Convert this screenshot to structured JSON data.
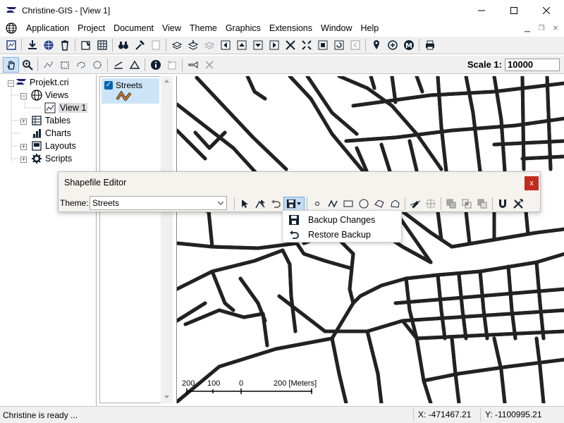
{
  "window": {
    "title": "Christine-GIS - [View 1]"
  },
  "menu": {
    "items": [
      "Application",
      "Project",
      "Document",
      "View",
      "Theme",
      "Graphics",
      "Extensions",
      "Window",
      "Help"
    ]
  },
  "scale": {
    "label": "Scale 1:",
    "value": "10000"
  },
  "tree": {
    "project": "Projekt.cri",
    "views": "Views",
    "view1": "View 1",
    "tables": "Tables",
    "charts": "Charts",
    "layouts": "Layouts",
    "scripts": "Scripts"
  },
  "legend": {
    "theme_name": "Streets",
    "checked": true
  },
  "dialog": {
    "title": "Shapefile Editor",
    "close": "x",
    "theme_label": "Theme:",
    "theme_value": "Streets"
  },
  "popup": {
    "items": [
      "Backup Changes",
      "Restore Backup"
    ]
  },
  "scalebar": {
    "labels": [
      "200",
      "100",
      "0",
      "200 [Meters]"
    ]
  },
  "status": {
    "text": "Christine is ready ...",
    "x": "X: -471467.21",
    "y": "Y: -1100995.21"
  },
  "colors": {
    "street": "#e07b1a",
    "accent": "#0063b1"
  }
}
